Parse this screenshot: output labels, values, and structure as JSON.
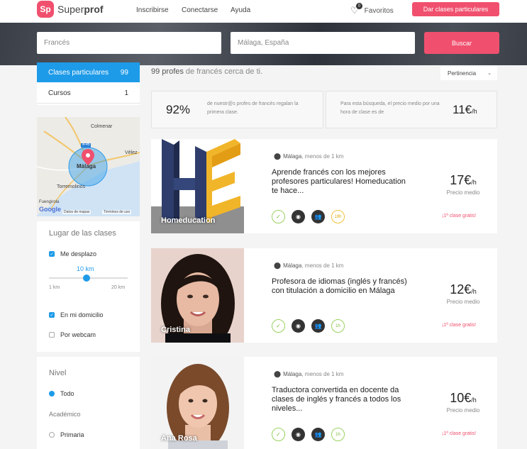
{
  "nav": {
    "logo_badge": "Sp",
    "logo_prefix": "Super",
    "logo_suffix": "prof",
    "links": [
      "Inscribirse",
      "Conectarse",
      "Ayuda"
    ],
    "favorites_label": "Favoritos",
    "favorites_count": "0",
    "cta_label": "Dar clases particulares"
  },
  "search": {
    "subject_value": "Francés",
    "location_value": "Málaga, España",
    "button_label": "Buscar"
  },
  "sidebar": {
    "tabs": [
      {
        "label": "Clases particulares",
        "count": "99"
      },
      {
        "label": "Cursos",
        "count": "1"
      }
    ],
    "map": {
      "labels": [
        "Colmenar",
        "Vélez",
        "Málaga",
        "Torremolinos",
        "Fuengirola"
      ],
      "road_label": "A-45",
      "attribution": "Datos de mapas",
      "terms": "Términos de uso",
      "google": "Google"
    },
    "place_title": "Lugar de las clases",
    "place_options": [
      {
        "label": "Me desplazo",
        "checked": true
      },
      {
        "label": "En mi domicilio",
        "checked": true
      },
      {
        "label": "Por webcam",
        "checked": false
      }
    ],
    "distance": {
      "value": "10 km",
      "min": "1 km",
      "max": "20 km",
      "fraction": 0.47
    },
    "level_title": "Nivel",
    "level_all": "Todo",
    "academic_title": "Académico",
    "academic_first": "Primaria"
  },
  "results": {
    "count_strong": "99 profes",
    "count_rest": " de francés cerca de ti.",
    "sort_label": "Pertinencia",
    "stat1_value": "92%",
    "stat1_text": "de nuestr@s profes de francés regalan la primera clase.",
    "stat2_text": "Para esta búsqueda, el precio medio por una hora de clase es de",
    "stat2_value": "11€",
    "stat2_unit": "/h",
    "cards": [
      {
        "name": "Homeducation",
        "city": "Málaga",
        "distance": ", menos de 1 km",
        "headline": "Aprende francés con los mejores profesores particulares! Homeducation te hace...",
        "price": "17€",
        "unit": "/h",
        "price_label": "Precio medio",
        "free": "¡1ª clase gratis!",
        "hours": "19h"
      },
      {
        "name": "Cristina",
        "city": "Málaga",
        "distance": ", menos de 1 km",
        "headline": "Profesora de idiomas (inglés y francés) con titulación a domicilio en Málaga",
        "price": "12€",
        "unit": "/h",
        "price_label": "Precio medio",
        "free": "¡1ª clase gratis!",
        "hours": "1h"
      },
      {
        "name": "Ana Rosa",
        "city": "Málaga",
        "distance": ", menos de 1 km",
        "headline": "Traductora convertida en docente da clases de inglés y francés a todos los niveles...",
        "price": "10€",
        "unit": "/h",
        "price_label": "Precio medio",
        "free": "¡1ª clase gratis!",
        "hours": "1h"
      }
    ]
  },
  "colors": {
    "brand": "#f0506e",
    "accent": "#1e9be8"
  }
}
